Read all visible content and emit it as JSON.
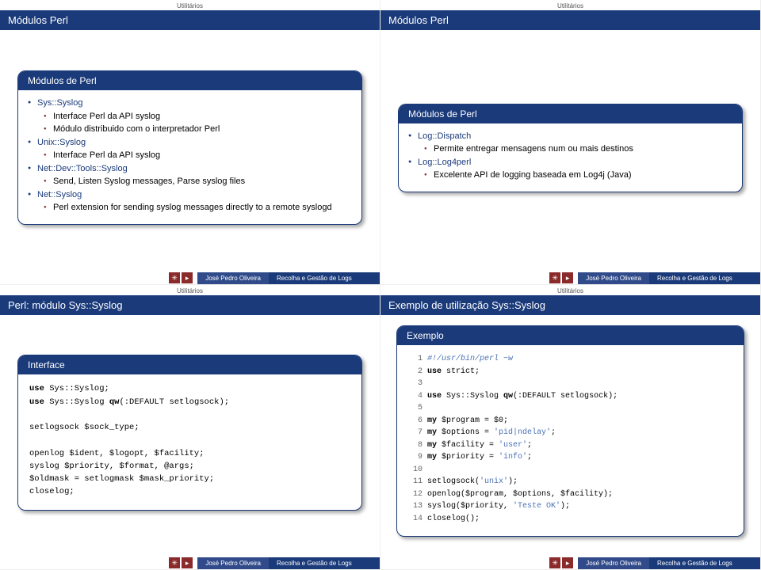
{
  "nav": {
    "item": "Utilitários"
  },
  "footer": {
    "author": "José Pedro Oliveira",
    "title": "Recolha e Gestão de Logs"
  },
  "s1": {
    "title": "Módulos Perl",
    "box": "Módulos de Perl",
    "i": {
      "sys": "Sys::Syslog",
      "sys1": "Interface Perl da API syslog",
      "sys2": "Módulo distribuido com o interpretador Perl",
      "unix": "Unix::Syslog",
      "unix1": "Interface Perl da API syslog",
      "dev": "Net::Dev::Tools::Syslog",
      "dev1": "Send, Listen Syslog messages, Parse syslog files",
      "net": "Net::Syslog",
      "net1": "Perl extension for sending syslog messages directly to a remote syslogd"
    }
  },
  "s2": {
    "title": "Módulos Perl",
    "box": "Módulos de Perl",
    "i": {
      "disp": "Log::Dispatch",
      "disp1": "Permite entregar mensagens num ou mais destinos",
      "l4": "Log::Log4perl",
      "l41": "Excelente API de logging baseada em Log4j (Java)"
    }
  },
  "s3": {
    "title": "Perl: módulo Sys::Syslog",
    "box": "Interface",
    "code": {
      "l1a": "use",
      "l1b": " Sys::Syslog;",
      "l2a": "use",
      "l2b": " Sys::Syslog ",
      "l2c": "qw",
      "l2d": "(:DEFAULT setlogsock);",
      "l3": "setlogsock $sock_type;",
      "l4": "openlog $ident, $logopt, $facility;",
      "l5": "syslog $priority, $format, @args;",
      "l6": "$oldmask = setlogmask $mask_priority;",
      "l7": "closelog;"
    }
  },
  "s4": {
    "title": "Exemplo de utilização Sys::Syslog",
    "box": "Exemplo",
    "code": {
      "l1": "#!/usr/bin/perl −w",
      "l2a": "use",
      "l2b": " strict;",
      "l4a": "use",
      "l4b": " Sys::Syslog ",
      "l4c": "qw",
      "l4d": "(:DEFAULT setlogsock);",
      "l6a": "my",
      "l6b": " $program = $0;",
      "l7a": "my",
      "l7b": " $options = ",
      "l7c": "'pid|ndelay'",
      "l7d": ";",
      "l8a": "my",
      "l8b": " $facility = ",
      "l8c": "'user'",
      "l8d": ";",
      "l9a": "my",
      "l9b": " $priority = ",
      "l9c": "'info'",
      "l9d": ";",
      "l11a": "setlogsock(",
      "l11b": "'unix'",
      "l11c": ");",
      "l12": "openlog($program, $options, $facility);",
      "l13a": "syslog($priority, ",
      "l13b": "'Teste OK'",
      "l13c": ");",
      "l14": "closelog();"
    }
  }
}
